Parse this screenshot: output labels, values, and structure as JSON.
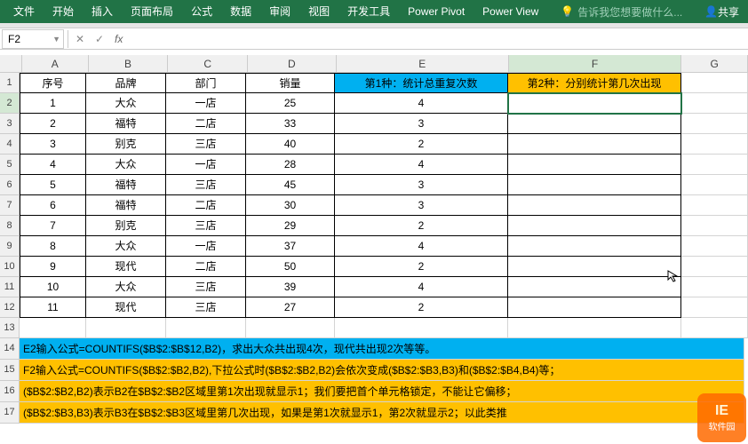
{
  "ribbon": {
    "tabs": [
      "文件",
      "开始",
      "插入",
      "页面布局",
      "公式",
      "数据",
      "审阅",
      "视图",
      "开发工具",
      "Power Pivot",
      "Power View"
    ],
    "tell_me_icon": "bulb-icon",
    "tell_me": "告诉我您想要做什么...",
    "share": "共享"
  },
  "formula_bar": {
    "name_box": "F2",
    "cancel": "✕",
    "confirm": "✓",
    "fx": "fx",
    "formula": ""
  },
  "columns": {
    "letters": [
      "A",
      "B",
      "C",
      "D",
      "E",
      "F",
      "G"
    ],
    "widths": [
      75,
      90,
      90,
      100,
      195,
      195,
      75
    ]
  },
  "row_numbers": [
    "1",
    "2",
    "3",
    "4",
    "5",
    "6",
    "7",
    "8",
    "9",
    "10",
    "11",
    "12",
    "13",
    "14",
    "15",
    "16",
    "17"
  ],
  "headers": {
    "A": "序号",
    "B": "品牌",
    "C": "部门",
    "D": "销量",
    "E": "第1种：统计总重复次数",
    "F": "第2种：分别统计第几次出现"
  },
  "table_rows": [
    {
      "seq": "1",
      "brand": "大众",
      "dept": "一店",
      "sales": "25",
      "e": "4"
    },
    {
      "seq": "2",
      "brand": "福特",
      "dept": "二店",
      "sales": "33",
      "e": "3"
    },
    {
      "seq": "3",
      "brand": "别克",
      "dept": "三店",
      "sales": "40",
      "e": "2"
    },
    {
      "seq": "4",
      "brand": "大众",
      "dept": "一店",
      "sales": "28",
      "e": "4"
    },
    {
      "seq": "5",
      "brand": "福特",
      "dept": "三店",
      "sales": "45",
      "e": "3"
    },
    {
      "seq": "6",
      "brand": "福特",
      "dept": "二店",
      "sales": "30",
      "e": "3"
    },
    {
      "seq": "7",
      "brand": "别克",
      "dept": "三店",
      "sales": "29",
      "e": "2"
    },
    {
      "seq": "8",
      "brand": "大众",
      "dept": "一店",
      "sales": "37",
      "e": "4"
    },
    {
      "seq": "9",
      "brand": "现代",
      "dept": "二店",
      "sales": "50",
      "e": "2"
    },
    {
      "seq": "10",
      "brand": "大众",
      "dept": "三店",
      "sales": "39",
      "e": "4"
    },
    {
      "seq": "11",
      "brand": "现代",
      "dept": "三店",
      "sales": "27",
      "e": "2"
    }
  ],
  "notes": {
    "line14": "E2输入公式=COUNTIFS($B$2:$B$12,B2)，求出大众共出现4次，现代共出现2次等等。",
    "line15": "F2输入公式=COUNTIFS($B$2:$B2,B2),下拉公式时($B$2:$B2,B2)会依次变成($B$2:$B3,B3)和($B$2:$B4,B4)等；",
    "line16": "($B$2:$B2,B2)表示B2在$B$2:$B2区域里第1次出现就显示1；我们要把首个单元格锁定，不能让它偏移；",
    "line17": "($B$2:$B3,B3)表示B3在$B$2:$B3区域里第几次出现，如果是第1次就显示1，第2次就显示2；以此类推"
  },
  "active_cell": "F2",
  "watermark": {
    "top": "IE",
    "bottom": "软件园"
  }
}
